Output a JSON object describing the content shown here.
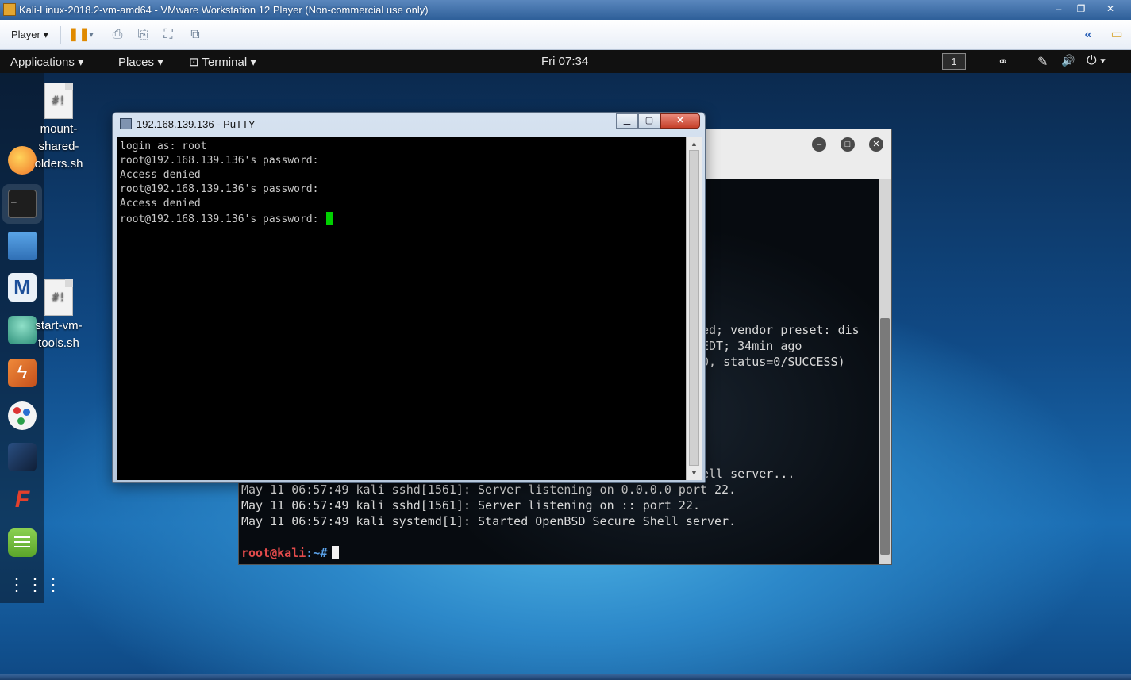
{
  "vmware": {
    "title": "Kali-Linux-2018.2-vm-amd64 - VMware Workstation 12 Player (Non-commercial use only)",
    "minimize": "–",
    "restore": "❐",
    "close": "✕",
    "player_menu": "Player ▾",
    "pause_glyph": "❚❚",
    "pause_dropdown": "▾",
    "tool_icons": [
      "⎙",
      "⎘",
      "⛶",
      "⧉"
    ],
    "right_icons": [
      "«",
      "▭"
    ]
  },
  "panel": {
    "applications": "Applications ▾",
    "places": "Places ▾",
    "terminal": "⊡ Terminal ▾",
    "clock": "Fri 07:34",
    "workspace": "1",
    "net_icon": "⚭",
    "pen_icon": "✎",
    "volume_icon": "🔊",
    "power_icon": "⏻ ▾"
  },
  "desktop_files": [
    {
      "label": "mount-shared-folders.sh",
      "line1": "mount-",
      "line2": "shared-",
      "line3": "olders.sh",
      "glyph": "#!"
    },
    {
      "label": "start-vm-tools.sh",
      "line1": "start-vm-",
      "line2": "tools.sh",
      "glyph": "#!"
    }
  ],
  "dock": {
    "apps": [
      "firefox",
      "terminal",
      "files",
      "metasploit",
      "armitage",
      "burpsuite",
      "maltego",
      "beef",
      "faraday",
      "leafpad",
      "show-apps"
    ],
    "colors": {
      "firefox": "#f29a2e",
      "terminal": "#222222",
      "files": "#3d82c8",
      "metasploit": "#2a5fa8",
      "armitage": "#3fa08a",
      "burpsuite": "#e0692b",
      "maltego": "#eaeaea",
      "beef": "#1e3c6a",
      "faraday": "#e43d2f",
      "leafpad": "#77c043",
      "show_apps": "#ffffff"
    }
  },
  "putty": {
    "title": "192.168.139.136 - PuTTY",
    "btn_min": "▁",
    "btn_max": "▢",
    "btn_close": "✕",
    "lines": [
      "login as: root",
      "root@192.168.139.136's password:",
      "Access denied",
      "root@192.168.139.136's password:",
      "Access denied",
      "root@192.168.139.136's password: "
    ],
    "scroll_up": "▲",
    "scroll_down": "▼"
  },
  "kali_terminal": {
    "btn_min": "–",
    "btn_max": "□",
    "btn_close": "✕",
    "partial_lines": [
      "ed; vendor preset: dis",
      "EDT; 34min ago",
      "0, status=0/SUCCESS)",
      "ell server..."
    ],
    "lines": [
      "May 11 06:57:49 kali sshd[1561]: Server listening on 0.0.0.0 port 22.",
      "May 11 06:57:49 kali sshd[1561]: Server listening on :: port 22.",
      "May 11 06:57:49 kali systemd[1]: Started OpenBSD Secure Shell server."
    ],
    "prompt_user": "root@kali",
    "prompt_rest": ":~#"
  }
}
